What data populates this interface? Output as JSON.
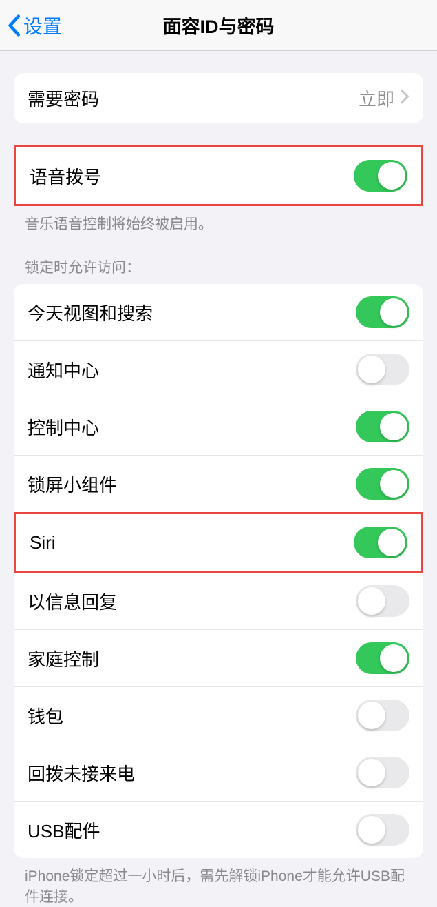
{
  "header": {
    "back_label": "设置",
    "title": "面容ID与密码"
  },
  "require_passcode": {
    "label": "需要密码",
    "value": "立即"
  },
  "voice_dial": {
    "label": "语音拨号",
    "on": true,
    "footer": "音乐语音控制将始终被启用。"
  },
  "locked_access": {
    "header": "锁定时允许访问：",
    "items": [
      {
        "label": "今天视图和搜索",
        "on": true
      },
      {
        "label": "通知中心",
        "on": false
      },
      {
        "label": "控制中心",
        "on": true
      },
      {
        "label": "锁屏小组件",
        "on": true
      },
      {
        "label": "Siri",
        "on": true
      },
      {
        "label": "以信息回复",
        "on": false
      },
      {
        "label": "家庭控制",
        "on": true
      },
      {
        "label": "钱包",
        "on": false
      },
      {
        "label": "回拨未接来电",
        "on": false
      },
      {
        "label": "USB配件",
        "on": false
      }
    ],
    "footer": "iPhone锁定超过一小时后，需先解锁iPhone才能允许USB配件连接。"
  }
}
